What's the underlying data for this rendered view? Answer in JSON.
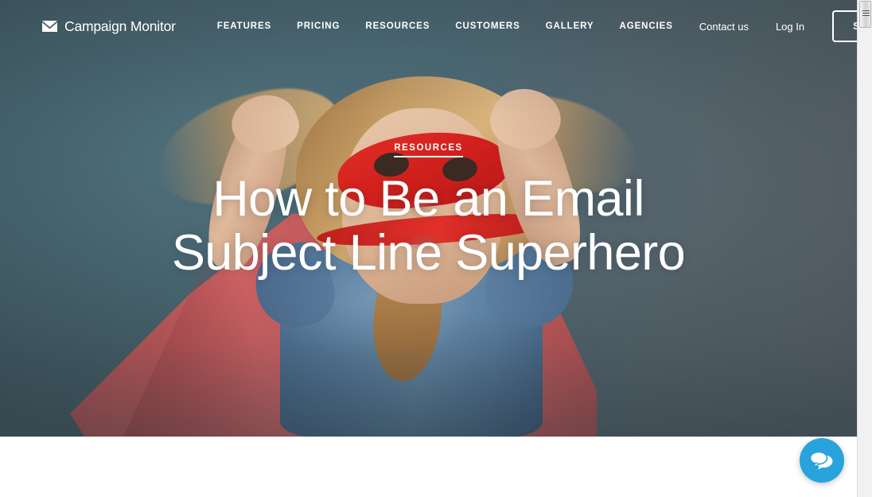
{
  "brand": {
    "name": "Campaign Monitor",
    "logo_icon": "envelope-logo-icon"
  },
  "nav": {
    "links": [
      {
        "label": "FEATURES"
      },
      {
        "label": "PRICING"
      },
      {
        "label": "RESOURCES"
      },
      {
        "label": "CUSTOMERS"
      },
      {
        "label": "GALLERY"
      },
      {
        "label": "AGENCIES"
      }
    ],
    "contact_label": "Contact us",
    "login_label": "Log In",
    "signup_label": "SIGN UP"
  },
  "hero": {
    "eyebrow": "RESOURCES",
    "title_line_1": "How to Be an Email",
    "title_line_2": "Subject Line Superhero",
    "image_alt": "girl-in-red-superhero-mask-and-cape"
  },
  "chat": {
    "icon": "chat-bubbles-icon",
    "color": "#29a3dc"
  },
  "scrollbar": {
    "grip_icon": "scrollbar-grip-icon"
  },
  "colors": {
    "hero_left": "#3f5f6b",
    "hero_right": "#5a636a",
    "cape_red": "#c2595a",
    "mask_red": "#d2211d",
    "shirt_blue": "#5b80a2",
    "chat_blue": "#29a3dc",
    "text_white": "#ffffff"
  }
}
